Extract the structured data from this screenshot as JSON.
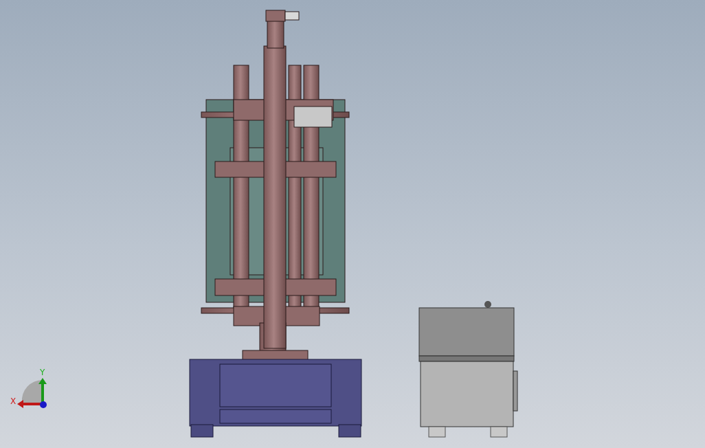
{
  "viewport": {
    "triad": {
      "x_label": "X",
      "y_label": "Y"
    }
  }
}
